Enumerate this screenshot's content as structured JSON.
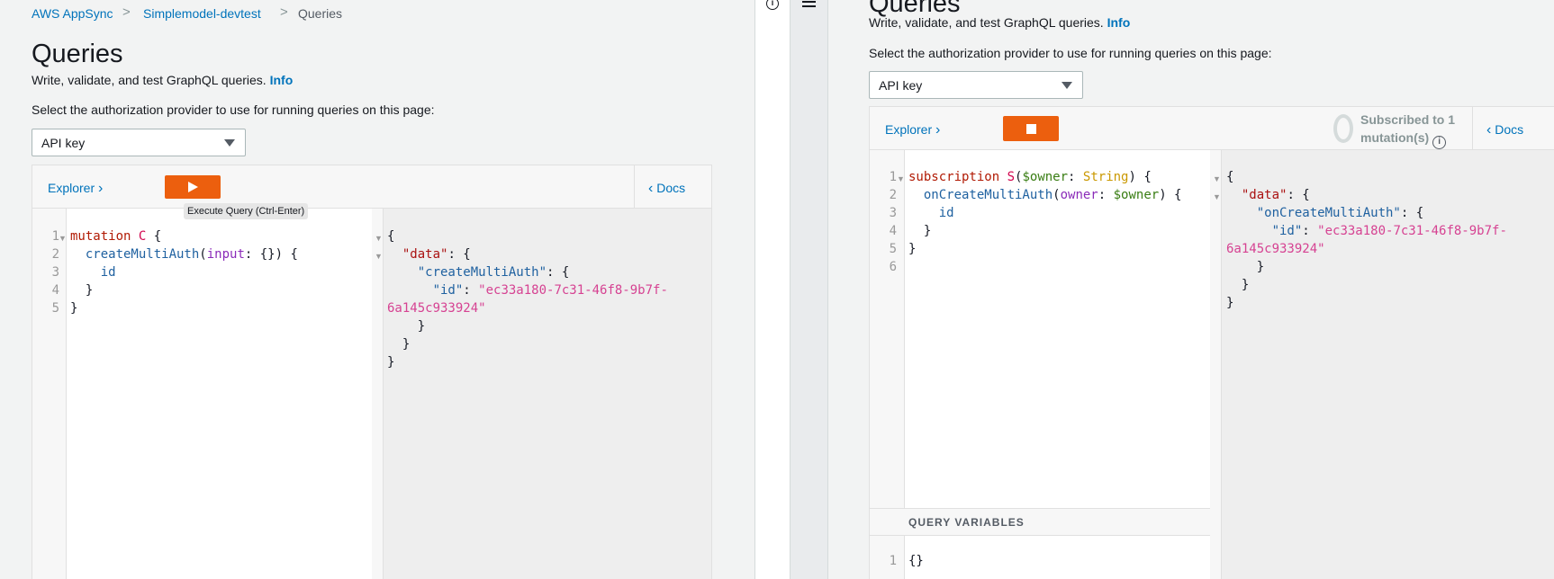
{
  "left": {
    "breadcrumb": [
      "AWS AppSync",
      "Simplemodel-devtest",
      "Queries"
    ],
    "title": "Queries",
    "subtitle": "Write, validate, and test GraphQL queries.",
    "info": "Info",
    "auth_label": "Select the authorization provider to use for running queries on this page:",
    "auth_value": "API key",
    "explorer": "Explorer",
    "docs": "Docs",
    "tooltip": "Execute Query (Ctrl-Enter)",
    "line_numbers": [
      "1",
      "2",
      "3",
      "4",
      "5"
    ],
    "response_id": "\"ec33a180-7c31-46f8-9b7f-",
    "response_id_cont": "6a145c933924\""
  },
  "right": {
    "title": "Queries",
    "subtitle": "Write, validate, and test GraphQL queries.",
    "info": "Info",
    "auth_label": "Select the authorization provider to use for running queries on this page:",
    "auth_value": "API key",
    "explorer": "Explorer",
    "docs": "Docs",
    "subscribed_line1": "Subscribed to 1",
    "subscribed_line2": "mutation(s)",
    "line_numbers": [
      "1",
      "2",
      "3",
      "4",
      "5",
      "6"
    ],
    "query_variables": "QUERY VARIABLES",
    "variables_line": "1",
    "variables_value": "{}",
    "response_id": "\"ec33a180-7c31-46f8-9b7f-",
    "response_id_cont": "6a145c933924\""
  },
  "icons": {
    "info": "info-icon",
    "menu": "hamburger-menu-icon"
  },
  "colors": {
    "accent": "#ec5f0e",
    "link": "#0073bb"
  }
}
